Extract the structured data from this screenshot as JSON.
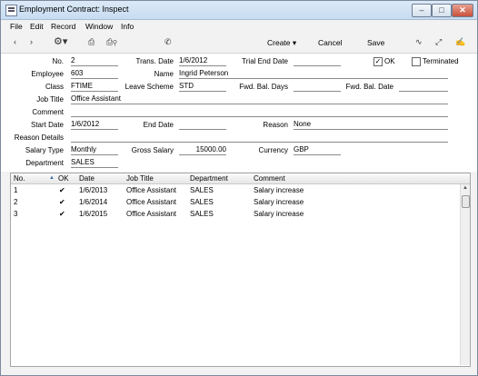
{
  "window": {
    "title": "Employment Contract: Inspect"
  },
  "menu": [
    "File",
    "Edit",
    "Record",
    "Window",
    "Info"
  ],
  "toolbar": {
    "create": "Create",
    "cancel": "Cancel",
    "save": "Save"
  },
  "form": {
    "no_label": "No.",
    "no": "2",
    "trans_date_label": "Trans. Date",
    "trans_date": "1/6/2012",
    "trial_end_label": "Trial End Date",
    "trial_end": "",
    "ok_label": "OK",
    "ok_checked": "✓",
    "terminated_label": "Terminated",
    "employee_label": "Employee",
    "employee": "603",
    "name_label": "Name",
    "name": "Ingrid Peterson",
    "class_label": "Class",
    "class": "FTIME",
    "leave_label": "Leave Scheme",
    "leave": "STD",
    "fwd_days_label": "Fwd. Bal. Days",
    "fwd_days": "",
    "fwd_date_label": "Fwd. Bal. Date",
    "fwd_date": "",
    "job_title_label": "Job Title",
    "job_title": "Office Assistant",
    "comment_label": "Comment",
    "comment": "",
    "start_label": "Start Date",
    "start": "1/6/2012",
    "end_label": "End Date",
    "end": "",
    "reason_label": "Reason",
    "reason": "None",
    "reason_details_label": "Reason Details",
    "reason_details": "",
    "salary_type_label": "Salary Type",
    "salary_type": "Monthly",
    "gross_label": "Gross Salary",
    "gross": "15000.00",
    "currency_label": "Currency",
    "currency": "GBP",
    "department_label": "Department",
    "department": "SALES"
  },
  "grid": {
    "headers": [
      "No.",
      "OK",
      "Date",
      "Job Title",
      "Department",
      "Comment"
    ],
    "rows": [
      [
        "1",
        "✔",
        "1/6/2013",
        "Office Assistant",
        "SALES",
        "Salary increase"
      ],
      [
        "2",
        "✔",
        "1/6/2014",
        "Office Assistant",
        "SALES",
        "Salary increase"
      ],
      [
        "3",
        "✔",
        "1/6/2015",
        "Office Assistant",
        "SALES",
        "Salary increase"
      ]
    ]
  }
}
